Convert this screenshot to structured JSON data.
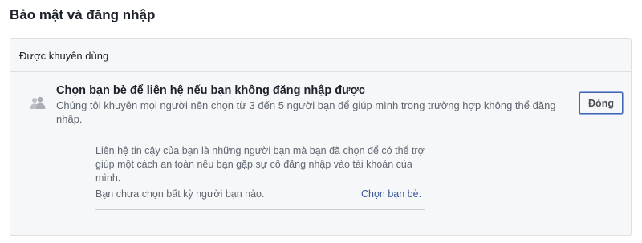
{
  "page": {
    "title": "Bảo mật và đăng nhập"
  },
  "section": {
    "header": "Được khuyên dùng"
  },
  "item": {
    "icon": "friends-icon",
    "title": "Chọn bạn bè để liên hệ nếu bạn không đăng nhập được",
    "description": "Chúng tôi khuyên mọi người nên chọn từ 3 đến 5 người bạn để giúp mình trong trường hợp không thể đăng nhập.",
    "close_label": "Đóng"
  },
  "trusted_contacts": {
    "description": "Liên hệ tin cậy của bạn là những người bạn mà bạn đã chọn để có thể trợ giúp một cách an toàn nếu bạn gặp sự cố đăng nhập vào tài khoản của mình.",
    "status": "Bạn chưa chọn bất kỳ người bạn nào.",
    "choose_link": "Chọn bạn bè."
  },
  "colors": {
    "link": "#365899",
    "button_border": "#4267b2",
    "panel_bg": "#f6f7f9"
  }
}
